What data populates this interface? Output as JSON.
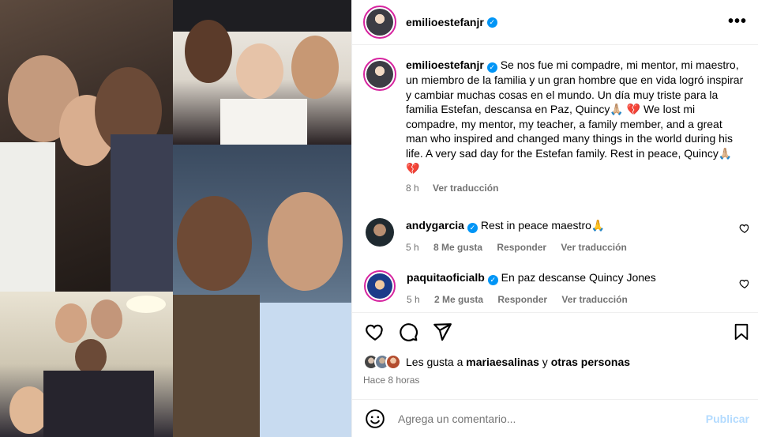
{
  "post": {
    "username": "emilioestefanjr",
    "more_icon": "more-horizontal-icon"
  },
  "caption": {
    "username": "emilioestefanjr",
    "text": " Se nos fue mi compadre, mi mentor, mi maestro, un miembro de la familia y un gran hombre que en vida logró inspirar y cambiar muchas cosas en el mundo. Un día muy triste para la familia Estefan, descansa en Paz, Quincy🙏🏼 💔  We lost mi compadre, my mentor, my teacher, a family member, and a great man who inspired and changed many things in the world during his life. A very sad day for the Estefan family. Rest in peace, Quincy🙏🏼 💔",
    "time": "8 h",
    "translate": "Ver traducción"
  },
  "comments": [
    {
      "username": "andygarcia",
      "text": " Rest in peace maestro🙏",
      "time": "5 h",
      "likes": "8 Me gusta",
      "reply": "Responder",
      "translate": "Ver traducción"
    },
    {
      "username": "paquitaoficialb",
      "text": " En paz descanse Quincy Jones",
      "time": "5 h",
      "likes": "2 Me gusta",
      "reply": "Responder",
      "translate": "Ver traducción"
    }
  ],
  "likes": {
    "prefix": "Les gusta a ",
    "user": "mariaesalinas",
    "middle": " y ",
    "others": "otras personas"
  },
  "timestamp": "Hace 8 horas",
  "composer": {
    "placeholder": "Agrega un comentario...",
    "post_label": "Publicar"
  },
  "colors": {
    "verified": "#0095f6",
    "ring": "#d6249f",
    "publish_disabled": "#b3dbff",
    "secondary_text": "#737373"
  }
}
